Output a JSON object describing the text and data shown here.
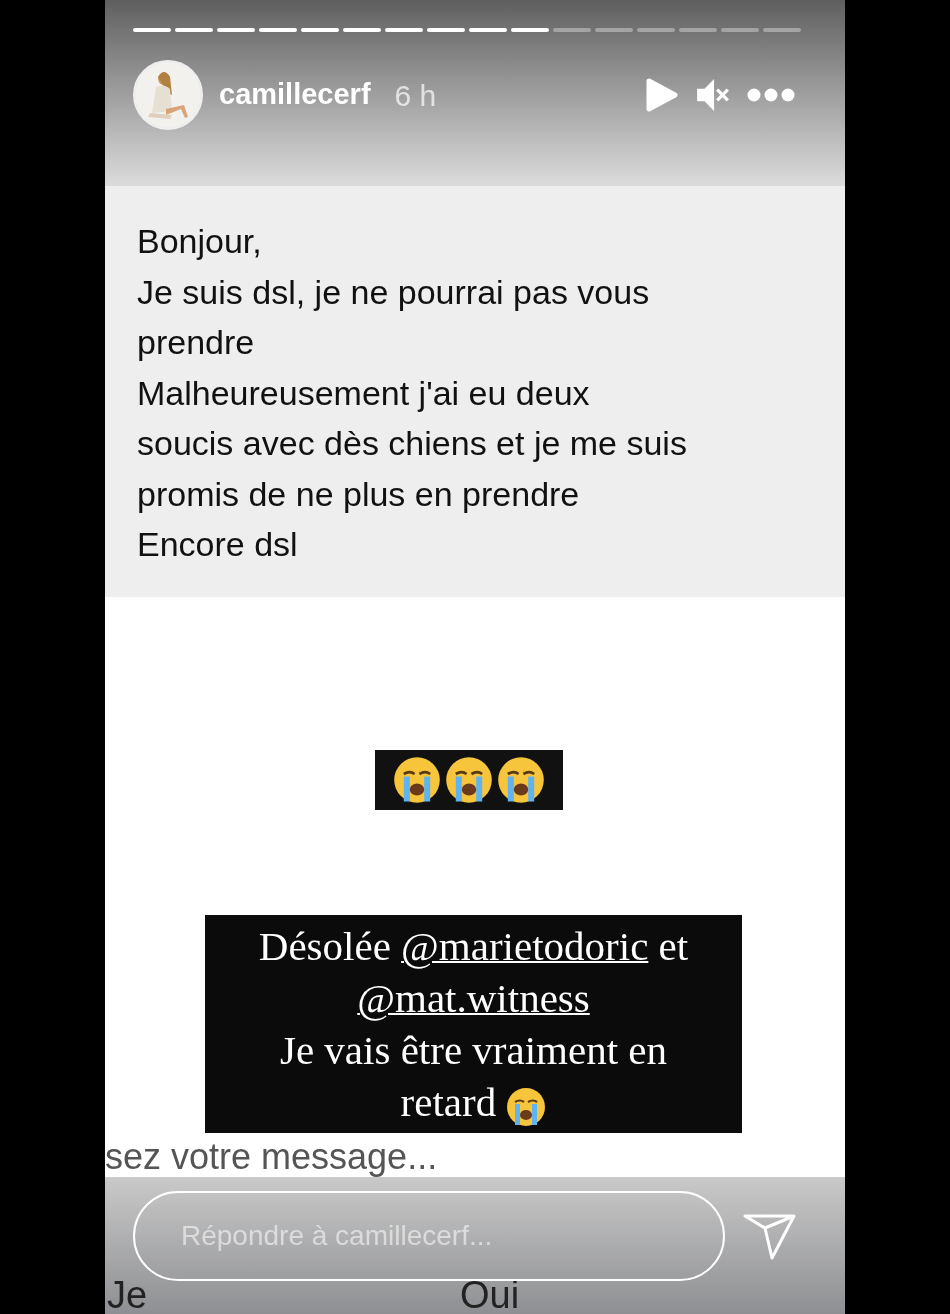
{
  "progress": [
    {
      "viewed": true
    },
    {
      "viewed": true
    },
    {
      "viewed": true
    },
    {
      "viewed": true
    },
    {
      "viewed": true
    },
    {
      "viewed": true
    },
    {
      "viewed": true
    },
    {
      "viewed": true
    },
    {
      "viewed": true
    },
    {
      "viewed": true
    },
    {
      "viewed": false
    },
    {
      "viewed": false
    },
    {
      "viewed": false
    },
    {
      "viewed": false
    },
    {
      "viewed": false
    },
    {
      "viewed": false
    }
  ],
  "header": {
    "username": "camillecerf",
    "time": "6 h",
    "muted": true
  },
  "message_lines": [
    "Bonjour,",
    "Je suis dsl, je ne pourrai pas vous",
    "prendre",
    "Malheureusement j'ai eu deux",
    "soucis avec dès chiens et je me suis",
    "promis de ne plus en prendre",
    "Encore dsl"
  ],
  "emoji_sticker": [
    {
      "kind": "crying"
    },
    {
      "kind": "crying"
    },
    {
      "kind": "crying"
    }
  ],
  "caption_lines": [
    [
      {
        "kind": "text",
        "text": "Désolée "
      },
      {
        "kind": "mention",
        "text": "@marietodoric"
      },
      {
        "kind": "text",
        "text": " et"
      }
    ],
    [
      {
        "kind": "mention",
        "text": "@mat.witness"
      }
    ],
    [
      {
        "kind": "text",
        "text": "Je vais être vraiment en"
      }
    ],
    [
      {
        "kind": "text",
        "text": "retard "
      },
      {
        "kind": "emoji"
      }
    ]
  ],
  "background_hint": "sez votre message...",
  "keyboard_keys": [
    "Je",
    "Oui"
  ],
  "reply": {
    "placeholder": "Répondre à camillecerf..."
  }
}
